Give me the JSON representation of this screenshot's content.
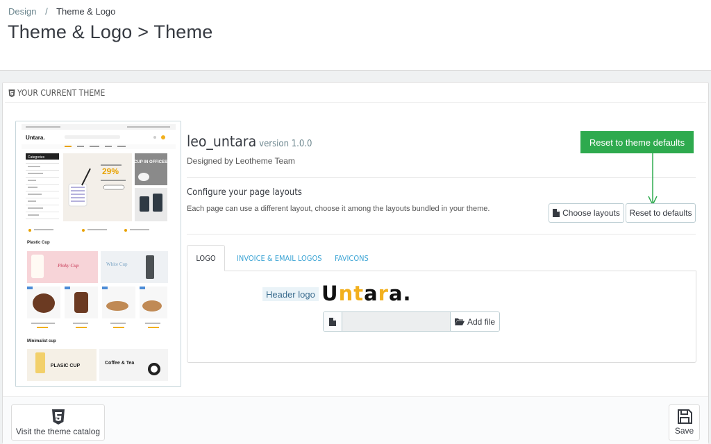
{
  "breadcrumb": {
    "parent": "Design",
    "separator": "/",
    "current": "Theme & Logo"
  },
  "page_title": "Theme & Logo > Theme",
  "panel": {
    "heading": "YOUR CURRENT THEME"
  },
  "theme": {
    "name": "leo_untara",
    "version": "version 1.0.0",
    "designed_by": "Designed by Leotheme Team"
  },
  "layouts": {
    "title": "Configure your page layouts",
    "description": "Each page can use a different layout, choose it among the layouts bundled in your theme.",
    "choose_label": "Choose layouts",
    "reset_label": "Reset to defaults"
  },
  "callout": {
    "text": "Reset to theme defaults",
    "color": "#2eaa4e"
  },
  "tabs": [
    {
      "label": "LOGO",
      "active": true
    },
    {
      "label": "INVOICE & EMAIL LOGOS",
      "active": false
    },
    {
      "label": "FAVICONS",
      "active": false
    }
  ],
  "logo_tab": {
    "header_logo_label": "Header logo",
    "logo_text": "Untara.",
    "add_file_label": "Add file"
  },
  "preview": {
    "logo": "Untara.",
    "sections": [
      "Plastic Cup",
      "Minimalist cup"
    ],
    "sidebar_title": "Categories",
    "hero_badge": "29%",
    "hero_title": "CUP IN OFFICES",
    "banner_pinky": "Pinky Cup",
    "banner_white": "White Cup",
    "banner_plasic": "PLASIC CUP",
    "banner_coffee": "Coffee & Tea"
  },
  "footer": {
    "visit_label": "Visit the theme catalog",
    "save_label": "Save"
  },
  "colors": {
    "accent_blue": "#3ea5d5",
    "text": "#363a41",
    "logo_yellow": "#f2b01e"
  }
}
